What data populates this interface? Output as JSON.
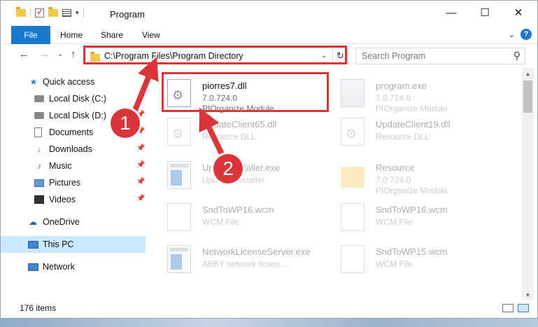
{
  "window": {
    "title": "Program",
    "minimize_label": "—",
    "maximize_label": "☐",
    "close_label": "✕"
  },
  "ribbon": {
    "tabs": [
      {
        "label": "File"
      },
      {
        "label": "Home"
      },
      {
        "label": "Share"
      },
      {
        "label": "View"
      }
    ],
    "collapse_label": "⌄",
    "help_label": "?"
  },
  "nav": {
    "back": "←",
    "forward": "→",
    "recent": "⌄",
    "up": "↑"
  },
  "address": {
    "path": "C:\\Program Files\\Program Directory",
    "dropdown": "⌄",
    "refresh": "↻"
  },
  "search": {
    "placeholder": "Search Program",
    "icon": "⚲"
  },
  "sidebar": {
    "items": [
      {
        "label": "Quick access",
        "icon": "star-icon"
      },
      {
        "label": "Local Disk (C:)",
        "icon": "disk-icon",
        "pin": "📌"
      },
      {
        "label": "Local Disk (D:)",
        "icon": "disk-icon",
        "pin": "📌"
      },
      {
        "label": "Documents",
        "icon": "document-icon",
        "pin": "📌"
      },
      {
        "label": "Downloads",
        "icon": "download-icon",
        "pin": "📌"
      },
      {
        "label": "Music",
        "icon": "music-icon",
        "pin": "📌"
      },
      {
        "label": "Pictures",
        "icon": "pictures-icon",
        "pin": "📌"
      },
      {
        "label": "Videos",
        "icon": "videos-icon",
        "pin": "📌"
      },
      {
        "label": "OneDrive",
        "icon": "cloud-icon"
      },
      {
        "label": "This PC",
        "icon": "computer-icon",
        "selected": true
      },
      {
        "label": "Network",
        "icon": "network-icon"
      }
    ]
  },
  "files": [
    {
      "name": "piorres7.dll",
      "line1": "7.0.724.0",
      "line2": "PIOrganize Module",
      "kind": "dll",
      "highlighted": true
    },
    {
      "name": "program.exe",
      "line1": "7.0.724.0",
      "line2": "PIOrganize Module",
      "kind": "program"
    },
    {
      "name": "UpdateClient65.dll",
      "line1": "Resource DLL",
      "line2": "",
      "kind": "dll"
    },
    {
      "name": "UpdateClient19.dll",
      "line1": "Resource DLL",
      "line2": "",
      "kind": "dll"
    },
    {
      "name": "UpdateInstaller.exe",
      "line1": "Updates installer",
      "line2": "",
      "kind": "exe"
    },
    {
      "name": "Resource",
      "line1": "7.0.724.0",
      "line2": "PIOrganize Module",
      "kind": "folder"
    },
    {
      "name": "SndToWP16.wcm",
      "line1": "WCM File",
      "line2": "",
      "kind": "blank"
    },
    {
      "name": "SndToWP16.wcm",
      "line1": "WCM File",
      "line2": "",
      "kind": "blank"
    },
    {
      "name": "NetworkLicenseServer.exe",
      "line1": "ABBY network licens...",
      "line2": "",
      "kind": "exe"
    },
    {
      "name": "SndToWP15.wcm",
      "line1": "WCM File",
      "line2": "",
      "kind": "blank"
    }
  ],
  "status": {
    "items_count": "176 items"
  },
  "annotations": {
    "step1": "1",
    "step2": "2",
    "color": "#d9353a"
  }
}
